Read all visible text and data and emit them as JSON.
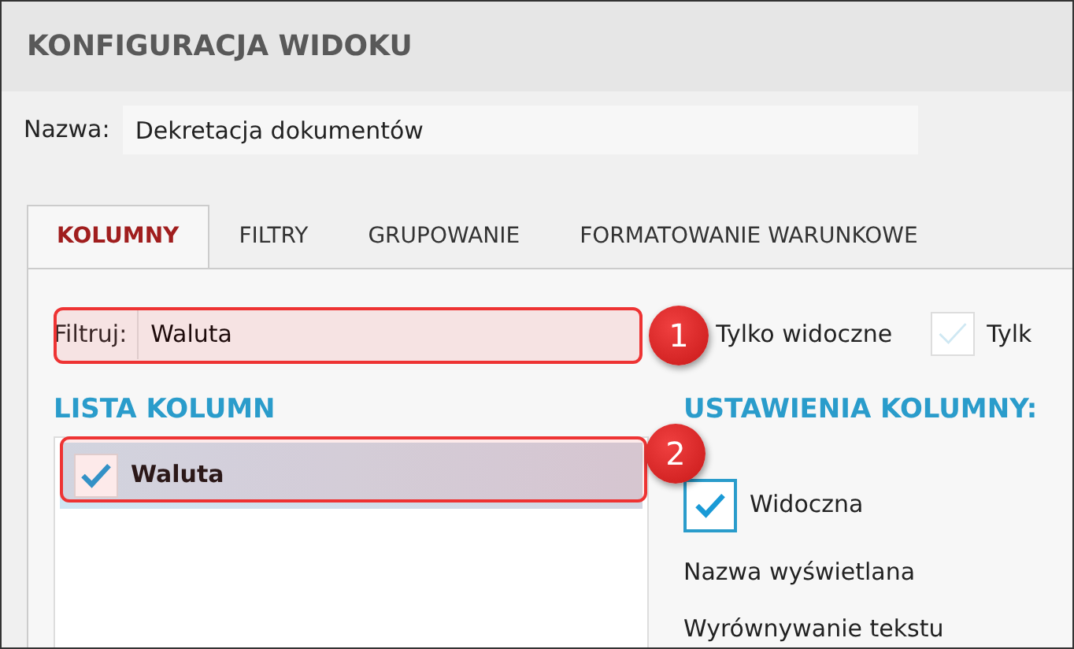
{
  "header": {
    "title": "KONFIGURACJA WIDOKU"
  },
  "name_field": {
    "label": "Nazwa:",
    "value": "Dekretacja dokumentów"
  },
  "tabs": [
    {
      "label": "KOLUMNY",
      "selected": true
    },
    {
      "label": "FILTRY",
      "selected": false
    },
    {
      "label": "GRUPOWANIE",
      "selected": false
    },
    {
      "label": "FORMATOWANIE WARUNKOWE",
      "selected": false
    }
  ],
  "filter": {
    "label": "Filtruj:",
    "value": "Waluta"
  },
  "filter_options": [
    {
      "label": "Tylko widoczne"
    },
    {
      "label": "Tylk",
      "checked": false
    }
  ],
  "column_list": {
    "title": "LISTA KOLUMN",
    "items": [
      {
        "label": "Waluta",
        "checked": true,
        "selected": true
      }
    ]
  },
  "column_settings": {
    "title": "USTAWIENIA KOLUMNY:",
    "visible": {
      "label": "Widoczna",
      "checked": true
    },
    "fields": [
      "Nazwa wyświetlana",
      "Wyrównywanie tekstu"
    ]
  },
  "callouts": [
    {
      "number": "1"
    },
    {
      "number": "2"
    }
  ]
}
